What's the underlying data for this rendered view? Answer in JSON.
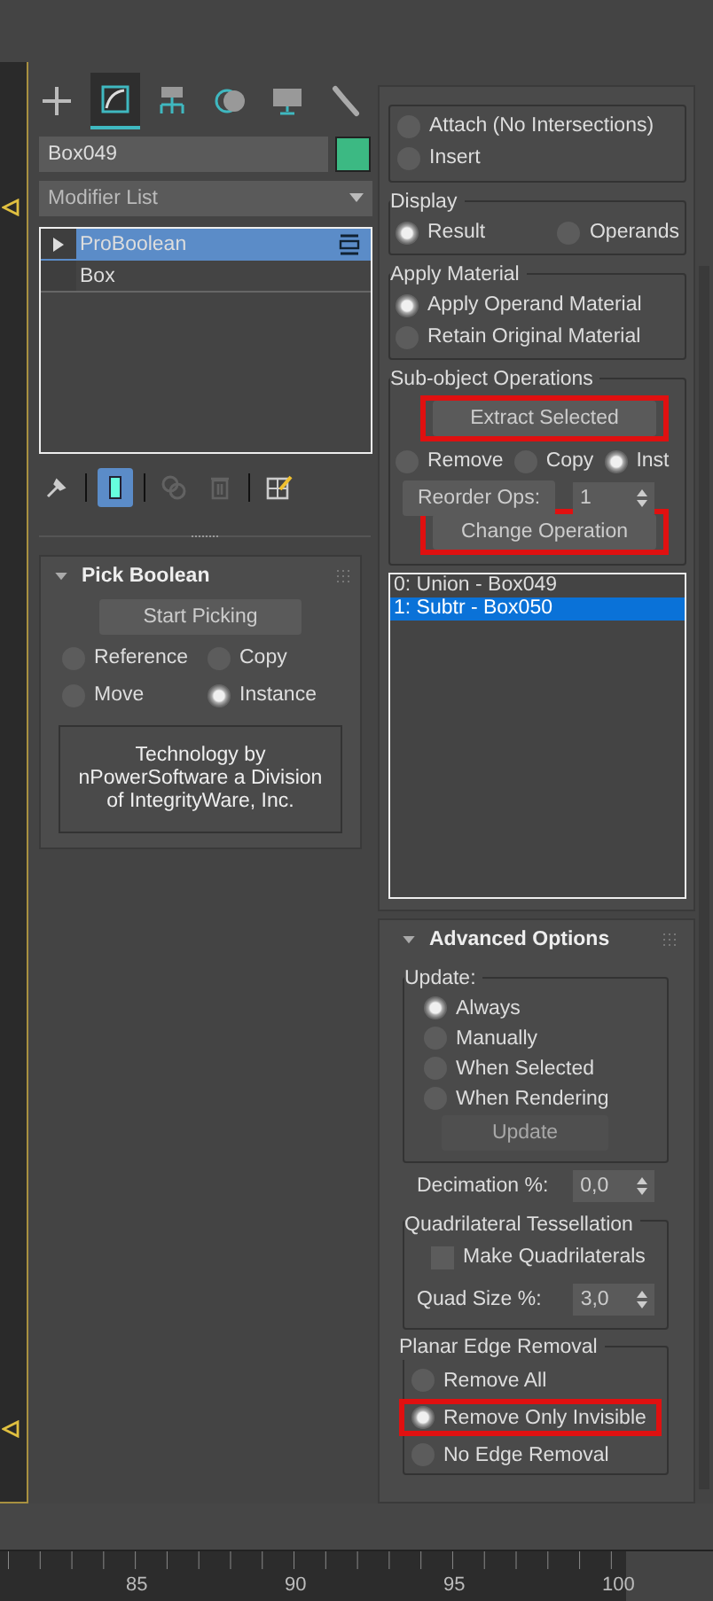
{
  "command_tabs": [
    {
      "kind": "create",
      "selected": false
    },
    {
      "kind": "modify",
      "selected": true
    },
    {
      "kind": "hierarchy",
      "selected": false
    },
    {
      "kind": "motion",
      "selected": false
    },
    {
      "kind": "display",
      "selected": false
    },
    {
      "kind": "utilities",
      "selected": false
    }
  ],
  "object_name": "Box049",
  "modifier_list": "Modifier List",
  "modifier_stack": [
    {
      "label": "ProBoolean",
      "selected": true,
      "expandable": true
    },
    {
      "label": "Box",
      "selected": false,
      "expandable": false
    }
  ],
  "stack_tools": [
    {
      "kind": "pin",
      "on": false,
      "disabled": false
    },
    {
      "kind": "show_end",
      "on": true,
      "disabled": false
    },
    {
      "kind": "make_unique",
      "on": false,
      "disabled": true
    },
    {
      "kind": "remove",
      "on": false,
      "disabled": true
    },
    {
      "kind": "configure",
      "on": false,
      "disabled": false
    }
  ],
  "pick_boolean": {
    "title": "Pick Boolean",
    "button": "Start Picking",
    "options": [
      {
        "label": "Reference",
        "selected": false
      },
      {
        "label": "Copy",
        "selected": false
      },
      {
        "label": "Move",
        "selected": false
      },
      {
        "label": "Instance",
        "selected": true
      }
    ],
    "credit": "Technology by\nnPowerSoftware a Division\nof IntegrityWare, Inc."
  },
  "operation_options": [
    {
      "label": "Attach (No Intersections)",
      "selected": false
    },
    {
      "label": "Insert",
      "selected": false
    }
  ],
  "display": {
    "title": "Display",
    "options": [
      {
        "label": "Result",
        "selected": true
      },
      {
        "label": "Operands",
        "selected": false
      }
    ]
  },
  "apply_material": {
    "title": "Apply Material",
    "options": [
      {
        "label": "Apply Operand Material",
        "selected": true
      },
      {
        "label": "Retain Original Material",
        "selected": false
      }
    ]
  },
  "sub_object": {
    "title": "Sub-object Operations",
    "extract_button": {
      "label": "Extract Selected",
      "highlighted": true
    },
    "options": [
      {
        "label": "Remove",
        "selected": false
      },
      {
        "label": "Copy",
        "selected": false
      },
      {
        "label": "Inst",
        "selected": true
      }
    ],
    "reorder_button": "Reorder Ops:",
    "reorder_value": "1",
    "change_button": {
      "label": "Change Operation",
      "highlighted": true
    }
  },
  "operands": [
    {
      "label": "0: Union - Box049",
      "selected": false
    },
    {
      "label": "1: Subtr - Box050",
      "selected": true
    }
  ],
  "advanced": {
    "title": "Advanced Options",
    "update_title": "Update:",
    "update_options": [
      {
        "label": "Always",
        "selected": true
      },
      {
        "label": "Manually",
        "selected": false
      },
      {
        "label": "When Selected",
        "selected": false
      },
      {
        "label": "When Rendering",
        "selected": false
      }
    ],
    "update_button": {
      "label": "Update",
      "disabled": true
    },
    "decimation_label": "Decimation %:",
    "decimation_value": "0,0",
    "quad_title": "Quadrilateral Tessellation",
    "make_quads": {
      "label": "Make Quadrilaterals",
      "checked": false
    },
    "quad_size_label": "Quad Size %:",
    "quad_size_value": "3,0",
    "planar_title": "Planar Edge Removal",
    "planar_options": [
      {
        "label": "Remove All",
        "selected": false,
        "highlighted": false
      },
      {
        "label": "Remove Only Invisible",
        "selected": true,
        "highlighted": true
      },
      {
        "label": "No Edge Removal",
        "selected": false,
        "highlighted": false
      }
    ]
  },
  "timeline": {
    "ticks": [
      "85",
      "90",
      "95",
      "100"
    ]
  }
}
